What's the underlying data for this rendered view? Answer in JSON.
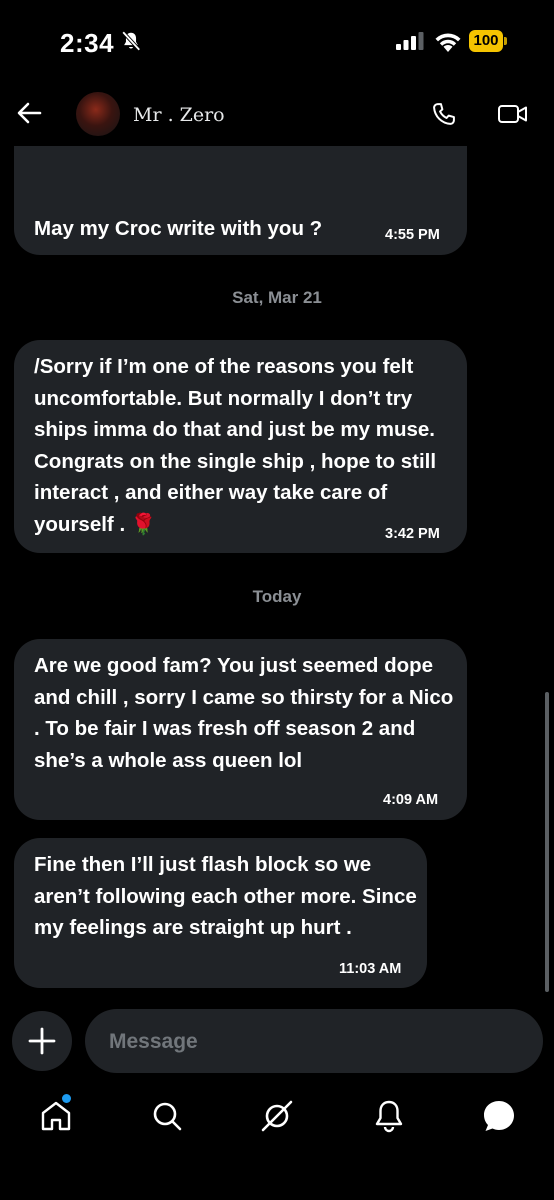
{
  "status_bar": {
    "time": "2:34",
    "battery": "100",
    "icons": [
      "bell-slash-icon",
      "signal-icon",
      "wifi-icon",
      "battery-icon"
    ],
    "battery_color": "#f5c400"
  },
  "header": {
    "contact_name": "Mr . Zero",
    "icons": [
      "back-arrow-icon",
      "phone-icon",
      "video-camera-icon"
    ]
  },
  "messages": [
    {
      "text": "May my Croc write with you ?",
      "time": "4:55 PM"
    },
    {
      "text": "/Sorry if I’m one of the reasons you felt uncomfortable. But normally I don’t try ships imma do that and just be my muse.  Congrats on the single ship , hope to still interact , and either way take care of yourself . 🌹",
      "time": "3:42 PM"
    },
    {
      "text": "Are we good fam? You just seemed dope and chill , sorry I came so thirsty for a Nico . To be fair I was fresh off season 2 and she’s a whole ass queen lol",
      "time": "4:09 AM"
    },
    {
      "text": "Fine then I’ll just flash block so we aren’t following each other more. Since my feelings are straight up hurt .",
      "time": "11:03 AM"
    }
  ],
  "date_separators": [
    "Sat, Mar 21",
    "Today"
  ],
  "composer": {
    "placeholder": "Message",
    "value": "",
    "add_icon": "plus-icon"
  },
  "tab_bar": {
    "items": [
      "home-icon",
      "search-icon",
      "grok-icon",
      "notifications-icon",
      "messages-icon"
    ],
    "active": "messages",
    "notification_dot_color": "#1d9bf0"
  },
  "colors": {
    "background": "#000000",
    "bubble": "#202327",
    "muted_text": "#8b8f94",
    "placeholder": "#71767b"
  }
}
